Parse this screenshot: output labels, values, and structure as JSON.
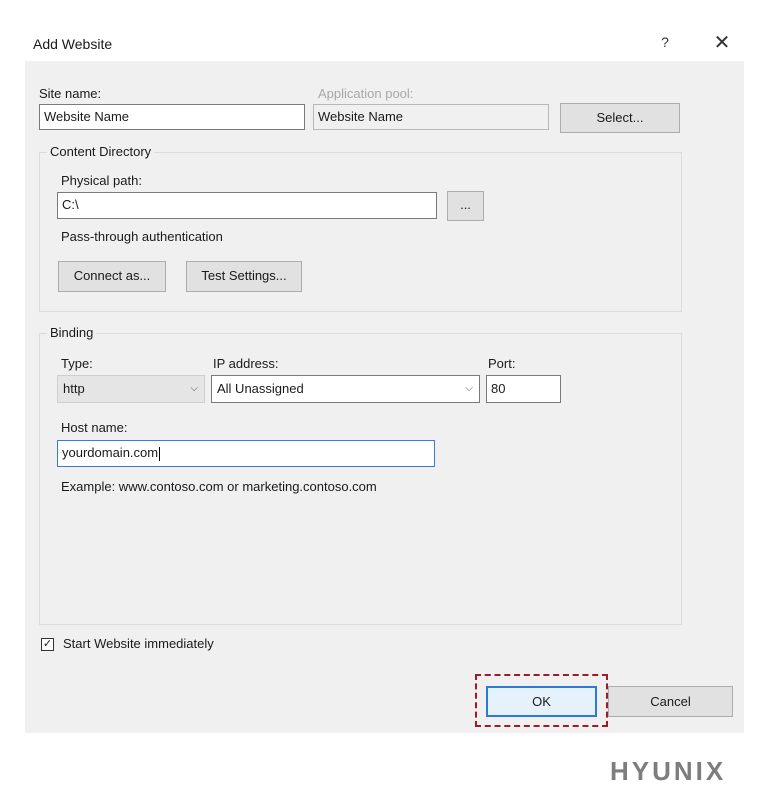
{
  "window": {
    "title": "Add Website",
    "help_label": "?",
    "close_label": "✕"
  },
  "site": {
    "site_name_label": "Site name:",
    "site_name_value": "Website Name",
    "app_pool_label": "Application pool:",
    "app_pool_value": "Website Name",
    "select_button": "Select..."
  },
  "content_directory": {
    "group_title": "Content Directory",
    "physical_path_label": "Physical path:",
    "physical_path_value": "C:\\",
    "browse_button": "...",
    "passthrough_label": "Pass-through authentication",
    "connect_as_button": "Connect as...",
    "test_settings_button": "Test Settings..."
  },
  "binding": {
    "group_title": "Binding",
    "type_label": "Type:",
    "type_value": "http",
    "ip_label": "IP address:",
    "ip_value": "All Unassigned",
    "port_label": "Port:",
    "port_value": "80",
    "host_label": "Host name:",
    "host_value": "yourdomain.com",
    "example_text": "Example: www.contoso.com or marketing.contoso.com"
  },
  "options": {
    "start_checkbox_label": "Start Website immediately",
    "start_checked": true,
    "check_mark": "✓"
  },
  "footer": {
    "ok_button": "OK",
    "cancel_button": "Cancel"
  },
  "watermark": {
    "text": "HYUNIX"
  },
  "icons": {
    "dropdown": "⌵"
  },
  "colors": {
    "highlight_border": "#9b1c2e",
    "focus_blue": "#3a7bd5",
    "dialog_bg": "#f0f0f0"
  }
}
